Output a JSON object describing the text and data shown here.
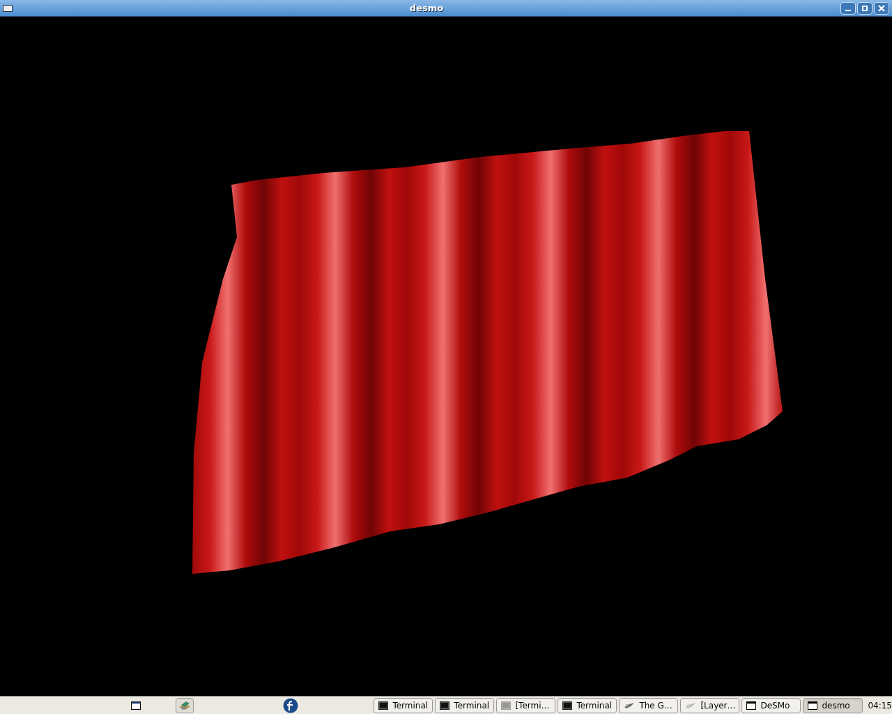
{
  "window": {
    "title": "desmo"
  },
  "taskbar": {
    "tasks": [
      {
        "kind": "terminal",
        "label": "Terminal",
        "minimized": false,
        "selected": false
      },
      {
        "kind": "terminal",
        "label": "Terminal",
        "minimized": false,
        "selected": false
      },
      {
        "kind": "terminal",
        "label": "[Termi…",
        "minimized": true,
        "selected": false
      },
      {
        "kind": "terminal",
        "label": "Terminal",
        "minimized": false,
        "selected": false
      },
      {
        "kind": "gimp",
        "label": "The G…",
        "minimized": false,
        "selected": false
      },
      {
        "kind": "gimp",
        "label": "[Layer…",
        "minimized": true,
        "selected": false
      },
      {
        "kind": "window",
        "label": "DeSMo",
        "minimized": false,
        "selected": false
      },
      {
        "kind": "window",
        "label": "desmo",
        "minimized": false,
        "selected": true
      }
    ],
    "clock": "04:15"
  }
}
